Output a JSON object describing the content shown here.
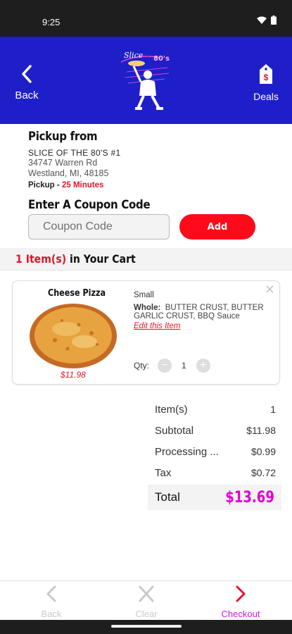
{
  "status": {
    "time": "9:25",
    "icons": [
      "wifi-icon",
      "battery-icon"
    ]
  },
  "header": {
    "back_label": "Back",
    "deals_label": "Deals",
    "logo_text": "Slice of the 80's",
    "deals_badge": "$"
  },
  "pickup": {
    "title": "Pickup from",
    "store_name": "SLICE OF THE 80'S #1",
    "address_line1": "34747 Warren Rd",
    "address_line2": "Westland, MI, 48185",
    "pickup_label": "Pickup",
    "pickup_sep": " - ",
    "pickup_time": "25 Minutes"
  },
  "coupon": {
    "title": "Enter A Coupon Code",
    "placeholder": "Coupon Code",
    "add_label": "Add"
  },
  "cart": {
    "count": "1 Item(s)",
    "suffix": " in Your Cart"
  },
  "item": {
    "name": "Cheese Pizza",
    "price": "$11.98",
    "size": "Small",
    "options_label": "Whole:",
    "options_value": "BUTTER CRUST, BUTTER GARLIC CRUST, BBQ Sauce",
    "edit_label": "Edit this Item",
    "qty_label": "Qty:",
    "qty_value": "1",
    "minus": "−",
    "plus": "+",
    "close": "✕"
  },
  "summary": {
    "rows": [
      {
        "label": "Item(s)",
        "value": "1"
      },
      {
        "label": "Subtotal",
        "value": "$11.98"
      },
      {
        "label": "Processing ...",
        "value": "$0.99"
      },
      {
        "label": "Tax",
        "value": "$0.72"
      }
    ],
    "total_label": "Total",
    "total_value": "$13.69"
  },
  "bottom_nav": {
    "back_label": "Back",
    "clear_label": "Clear",
    "checkout_label": "Checkout"
  },
  "colors": {
    "brand_blue": "#1f1fc9",
    "accent_red": "#e3142b",
    "total_magenta": "#e000d4"
  }
}
